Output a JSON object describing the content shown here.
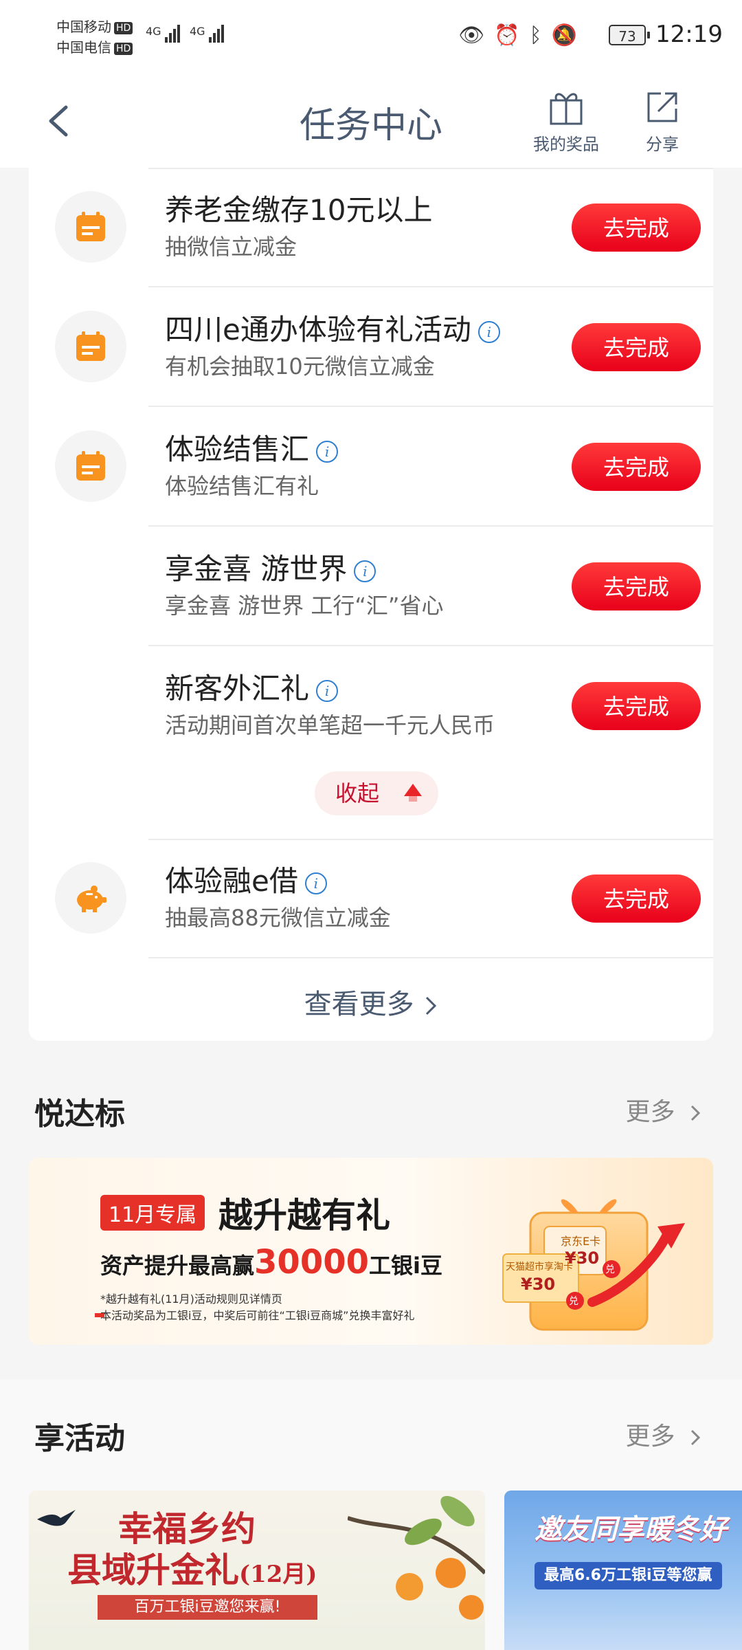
{
  "status_bar": {
    "carrier1": "中国移动",
    "carrier2": "中国电信",
    "hd": "HD",
    "net1": "4G",
    "net2": "4G",
    "battery": "73",
    "time": "12:19"
  },
  "header": {
    "title": "任务中心",
    "prizes_label": "我的奖品",
    "share_label": "分享"
  },
  "tasks": [
    {
      "name": "养老金缴存10元以上",
      "desc": "抽微信立减金",
      "button": "去完成",
      "info": false,
      "icon": "calendar-icon"
    },
    {
      "name": "四川e通办体验有礼活动",
      "desc": "有机会抽取10元微信立减金",
      "button": "去完成",
      "info": true,
      "icon": "calendar-icon"
    },
    {
      "name": "体验结售汇",
      "desc": "体验结售汇有礼",
      "button": "去完成",
      "info": true,
      "icon": "calendar-icon"
    },
    {
      "name": "享金喜 游世界",
      "desc": "享金喜 游世界 工行“汇”省心",
      "button": "去完成",
      "info": true,
      "icon": ""
    },
    {
      "name": "新客外汇礼",
      "desc": "活动期间首次单笔超一千元人民币",
      "button": "去完成",
      "info": true,
      "icon": ""
    },
    {
      "name": "体验融e借",
      "desc": "抽最高88元微信立减金",
      "button": "去完成",
      "info": true,
      "icon": "piggy-bank-icon"
    }
  ],
  "collapse_label": "收起",
  "view_more_label": "查看更多",
  "section1": {
    "title": "悦达标",
    "more": "更多",
    "banner": {
      "tag": "11月专属",
      "title": "越升越有礼",
      "line_prefix": "资产提升最高赢",
      "line_amount": "30000",
      "line_suffix": "工银i豆",
      "note1": "*越升越有礼(11月)活动规则见详情页",
      "note2": "本活动奖品为工银i豆，中奖后可前往“工银i豆商城”兑换丰富好礼",
      "card1_label": "京东E卡",
      "card1_value": "¥30",
      "card2_label": "天猫超市享淘卡",
      "card2_value": "¥30",
      "redeem": "兑"
    }
  },
  "section2": {
    "title": "享活动",
    "more": "更多",
    "banner1": {
      "title1": "幸福乡约",
      "title2": "县域升金礼",
      "month": "(12月)",
      "sub": "百万工银i豆邀您来赢!"
    },
    "banner2": {
      "title": "邀友同享暖冬好",
      "sub": "最高6.6万工银i豆等您赢"
    }
  },
  "colors": {
    "accent_red": "#e8001a",
    "title_blue_gray": "#4a5a70",
    "info_blue": "#2f7fd0",
    "icon_orange": "#f7931e"
  }
}
